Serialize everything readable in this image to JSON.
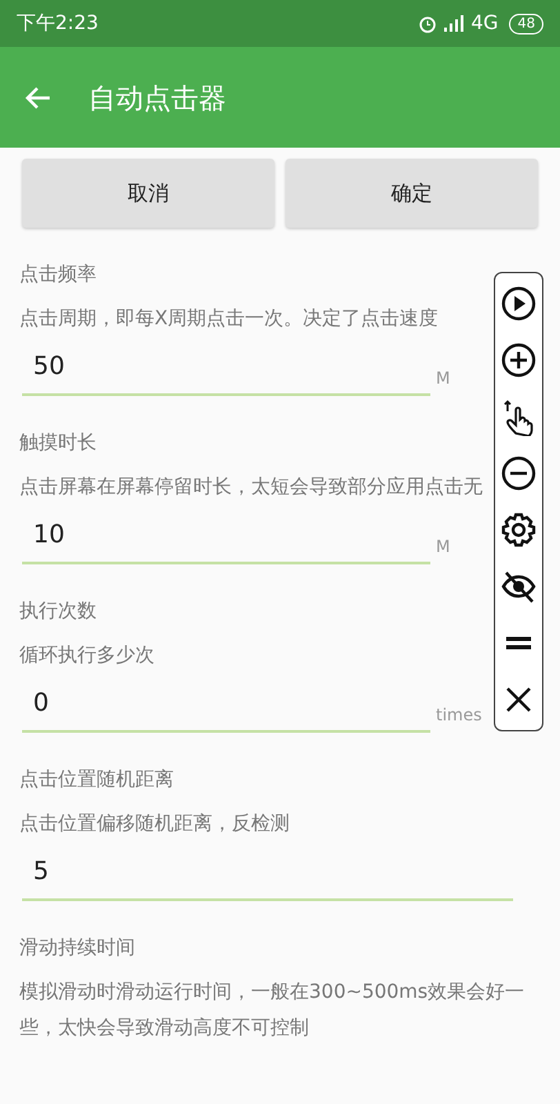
{
  "status_bar": {
    "time": "下午2:23",
    "network": "4G",
    "battery": "48"
  },
  "app_bar": {
    "title": "自动点击器"
  },
  "buttons": [
    {
      "label": "取消"
    },
    {
      "label": "确定"
    }
  ],
  "settings": [
    {
      "label": "点击频率",
      "description": "点击周期，即每X周期点击一次。决定了点击速度",
      "value": "50",
      "unit": "M"
    },
    {
      "label": "触摸时长",
      "description": "点击屏幕在屏幕停留时长，太短会导致部分应用点击无",
      "value": "10",
      "unit": "M"
    },
    {
      "label": "执行次数",
      "description": "循环执行多少次",
      "value": "0",
      "unit": "times"
    },
    {
      "label": "点击位置随机距离",
      "description": "点击位置偏移随机距离，反检测",
      "value": "5"
    },
    {
      "label": "滑动持续时间",
      "description": "模拟滑动时滑动运行时间，一般在300~500ms效果会好一些，太快会导致滑动高度不可控制"
    }
  ],
  "floating_toolbar": [
    {
      "kind": "play"
    },
    {
      "kind": "plus"
    },
    {
      "kind": "tap"
    },
    {
      "kind": "minus"
    },
    {
      "kind": "gear"
    },
    {
      "kind": "hide"
    },
    {
      "kind": "drag"
    },
    {
      "kind": "close"
    }
  ]
}
